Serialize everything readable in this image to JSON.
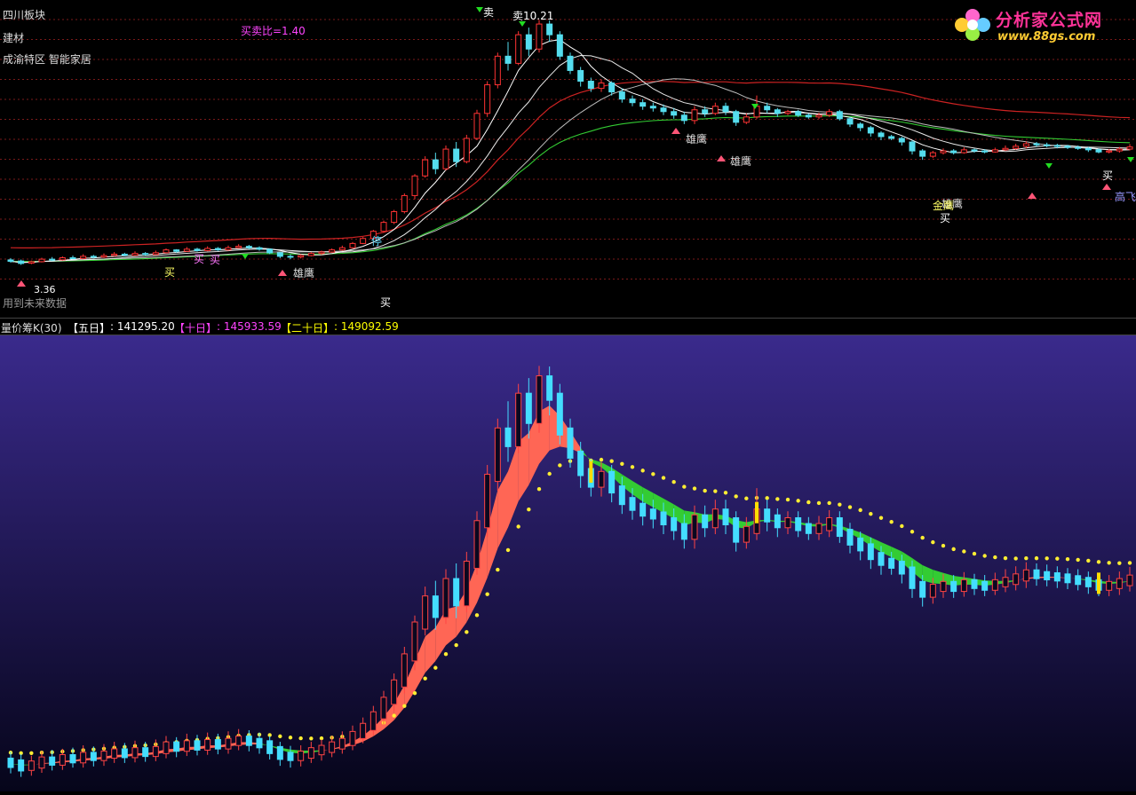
{
  "upper_panel": {
    "info_lines": [
      "四川板块",
      "建材",
      "成渝特区 智能家居"
    ],
    "ratio_label": "买卖比=1.40",
    "high_price_label": "卖10.21",
    "low_price_label": "3.36",
    "footer_text": "用到未来数据",
    "colors": {
      "ma5": "#ffffff",
      "ma10": "#e8e8e8",
      "ma20": "#bbbbbb",
      "ma60": "#33cc33",
      "band": "#cc2222",
      "grid": "#7a1a1a"
    }
  },
  "logo": {
    "text": "分析家公式网",
    "url": "www.88gs.com"
  },
  "divider": {
    "indicator_name": "量价筹K(30)",
    "five_day_label": "【五日】",
    "five_day_value": "141295.20",
    "ten_day_label": "【十日】",
    "ten_day_value": "145933.59",
    "twenty_day_label": "【二十日】",
    "twenty_day_value": "149092.59",
    "colors": {
      "five": "#ffffff",
      "ten": "#ff44ff",
      "twenty": "#ffff00"
    }
  },
  "signals": [
    {
      "text": "买",
      "color": "#ffff66"
    },
    {
      "text": "买",
      "color": "#ff77ff"
    },
    {
      "text": "买",
      "color": "#ff77ff"
    },
    {
      "text": "雄鹰",
      "color": "#dddddd"
    },
    {
      "text": "雄鹰",
      "color": "#dddddd"
    },
    {
      "text": "雄鹰",
      "color": "#dddddd"
    },
    {
      "text": "雄鹰",
      "color": "#dddddd"
    },
    {
      "text": "高飞",
      "color": "#9999ff"
    },
    {
      "text": "停",
      "color": "#66ddff"
    },
    {
      "text": "买",
      "color": "#ffffff"
    },
    {
      "text": "卖",
      "color": "#ffffff"
    },
    {
      "text": "金鹰",
      "color": "#ffff66"
    },
    {
      "text": "买",
      "color": "#ffffff"
    },
    {
      "text": "买",
      "color": "#ffffff"
    }
  ],
  "chart_data": {
    "type": "line",
    "candles": [
      [
        3.5,
        3.46,
        3.55,
        3.42
      ],
      [
        3.47,
        3.4,
        3.51,
        3.36
      ],
      [
        3.41,
        3.45,
        3.48,
        3.38
      ],
      [
        3.45,
        3.52,
        3.56,
        3.43
      ],
      [
        3.52,
        3.5,
        3.58,
        3.47
      ],
      [
        3.5,
        3.56,
        3.6,
        3.48
      ],
      [
        3.56,
        3.54,
        3.62,
        3.52
      ],
      [
        3.54,
        3.6,
        3.66,
        3.52
      ],
      [
        3.6,
        3.58,
        3.64,
        3.54
      ],
      [
        3.58,
        3.62,
        3.68,
        3.55
      ],
      [
        3.62,
        3.66,
        3.72,
        3.6
      ],
      [
        3.66,
        3.63,
        3.7,
        3.6
      ],
      [
        3.63,
        3.68,
        3.74,
        3.61
      ],
      [
        3.68,
        3.65,
        3.72,
        3.62
      ],
      [
        3.65,
        3.7,
        3.76,
        3.63
      ],
      [
        3.7,
        3.78,
        3.82,
        3.68
      ],
      [
        3.78,
        3.74,
        3.8,
        3.7
      ],
      [
        3.74,
        3.8,
        3.86,
        3.72
      ],
      [
        3.8,
        3.76,
        3.84,
        3.73
      ],
      [
        3.76,
        3.82,
        3.88,
        3.74
      ],
      [
        3.82,
        3.78,
        3.86,
        3.75
      ],
      [
        3.78,
        3.84,
        3.9,
        3.76
      ],
      [
        3.84,
        3.88,
        3.94,
        3.82
      ],
      [
        3.88,
        3.84,
        3.92,
        3.8
      ],
      [
        3.84,
        3.8,
        3.88,
        3.76
      ],
      [
        3.8,
        3.7,
        3.82,
        3.66
      ],
      [
        3.7,
        3.6,
        3.72,
        3.55
      ],
      [
        3.6,
        3.58,
        3.65,
        3.52
      ],
      [
        3.58,
        3.62,
        3.66,
        3.54
      ],
      [
        3.62,
        3.68,
        3.72,
        3.6
      ],
      [
        3.68,
        3.72,
        3.76,
        3.64
      ],
      [
        3.72,
        3.78,
        3.82,
        3.7
      ],
      [
        3.78,
        3.84,
        3.9,
        3.76
      ],
      [
        3.84,
        3.96,
        4.0,
        3.82
      ],
      [
        3.96,
        4.1,
        4.14,
        3.94
      ],
      [
        4.1,
        4.3,
        4.34,
        4.08
      ],
      [
        4.3,
        4.55,
        4.6,
        4.26
      ],
      [
        4.55,
        4.85,
        4.9,
        4.5
      ],
      [
        4.85,
        5.3,
        5.36,
        4.8
      ],
      [
        5.3,
        5.85,
        5.9,
        5.2
      ],
      [
        5.85,
        6.3,
        6.4,
        5.8
      ],
      [
        6.3,
        6.05,
        6.5,
        5.9
      ],
      [
        6.05,
        6.6,
        6.7,
        6.0
      ],
      [
        6.6,
        6.25,
        6.8,
        6.1
      ],
      [
        6.25,
        6.9,
        7.0,
        6.2
      ],
      [
        6.9,
        7.6,
        7.7,
        6.85
      ],
      [
        7.6,
        8.4,
        8.5,
        7.5
      ],
      [
        8.4,
        9.2,
        9.3,
        8.3
      ],
      [
        9.2,
        9.0,
        9.6,
        8.8
      ],
      [
        9.0,
        9.8,
        9.9,
        8.95
      ],
      [
        9.8,
        9.4,
        10.0,
        9.2
      ],
      [
        9.4,
        10.1,
        10.21,
        9.3
      ],
      [
        10.1,
        9.8,
        10.2,
        9.6
      ],
      [
        9.8,
        9.2,
        9.9,
        9.1
      ],
      [
        9.2,
        8.8,
        9.3,
        8.7
      ],
      [
        8.8,
        8.5,
        8.9,
        8.35
      ],
      [
        8.5,
        8.3,
        8.6,
        8.2
      ],
      [
        8.3,
        8.45,
        8.55,
        8.2
      ],
      [
        8.45,
        8.2,
        8.5,
        8.1
      ],
      [
        8.2,
        8.0,
        8.3,
        7.9
      ],
      [
        8.0,
        7.9,
        8.1,
        7.8
      ],
      [
        7.9,
        7.8,
        8.0,
        7.7
      ],
      [
        7.8,
        7.75,
        7.9,
        7.65
      ],
      [
        7.75,
        7.65,
        7.85,
        7.55
      ],
      [
        7.65,
        7.55,
        7.75,
        7.45
      ],
      [
        7.55,
        7.4,
        7.65,
        7.3
      ],
      [
        7.4,
        7.7,
        7.8,
        7.3
      ],
      [
        7.7,
        7.6,
        7.8,
        7.5
      ],
      [
        7.6,
        7.8,
        7.9,
        7.55
      ],
      [
        7.8,
        7.65,
        7.9,
        7.55
      ],
      [
        7.65,
        7.35,
        7.7,
        7.25
      ],
      [
        7.35,
        7.5,
        7.6,
        7.3
      ],
      [
        7.5,
        7.8,
        8.1,
        7.45
      ],
      [
        7.8,
        7.7,
        7.9,
        7.6
      ],
      [
        7.7,
        7.6,
        7.75,
        7.5
      ],
      [
        7.6,
        7.65,
        7.7,
        7.55
      ],
      [
        7.65,
        7.55,
        7.7,
        7.5
      ],
      [
        7.55,
        7.5,
        7.6,
        7.45
      ],
      [
        7.5,
        7.55,
        7.62,
        7.45
      ],
      [
        7.55,
        7.65,
        7.72,
        7.5
      ],
      [
        7.65,
        7.45,
        7.7,
        7.4
      ],
      [
        7.45,
        7.3,
        7.5,
        7.22
      ],
      [
        7.3,
        7.2,
        7.35,
        7.1
      ],
      [
        7.2,
        7.05,
        7.25,
        6.95
      ],
      [
        7.05,
        6.95,
        7.1,
        6.85
      ],
      [
        6.95,
        6.9,
        7.0,
        6.85
      ],
      [
        6.9,
        6.8,
        6.95,
        6.7
      ],
      [
        6.8,
        6.55,
        6.85,
        6.45
      ],
      [
        6.55,
        6.4,
        6.6,
        6.3
      ],
      [
        6.4,
        6.5,
        6.55,
        6.35
      ],
      [
        6.5,
        6.55,
        6.62,
        6.45
      ],
      [
        6.55,
        6.5,
        6.6,
        6.45
      ],
      [
        6.5,
        6.58,
        6.65,
        6.47
      ],
      [
        6.58,
        6.55,
        6.62,
        6.5
      ],
      [
        6.55,
        6.52,
        6.6,
        6.48
      ],
      [
        6.52,
        6.58,
        6.64,
        6.5
      ],
      [
        6.58,
        6.62,
        6.7,
        6.55
      ],
      [
        6.62,
        6.68,
        6.75,
        6.58
      ],
      [
        6.68,
        6.75,
        6.82,
        6.62
      ],
      [
        6.75,
        6.72,
        6.8,
        6.66
      ],
      [
        6.72,
        6.7,
        6.78,
        6.65
      ],
      [
        6.7,
        6.68,
        6.75,
        6.62
      ],
      [
        6.68,
        6.65,
        6.72,
        6.6
      ],
      [
        6.65,
        6.62,
        6.7,
        6.58
      ],
      [
        6.62,
        6.58,
        6.66,
        6.52
      ],
      [
        6.58,
        6.52,
        6.62,
        6.48
      ],
      [
        6.52,
        6.55,
        6.6,
        6.48
      ],
      [
        6.55,
        6.6,
        6.66,
        6.5
      ],
      [
        6.6,
        6.66,
        6.74,
        6.56
      ]
    ],
    "series": [
      {
        "name": "【五日】"
      },
      {
        "name": "【十日】"
      },
      {
        "name": "【二十日】"
      }
    ],
    "ylim": [
      3.2,
      10.4
    ]
  }
}
